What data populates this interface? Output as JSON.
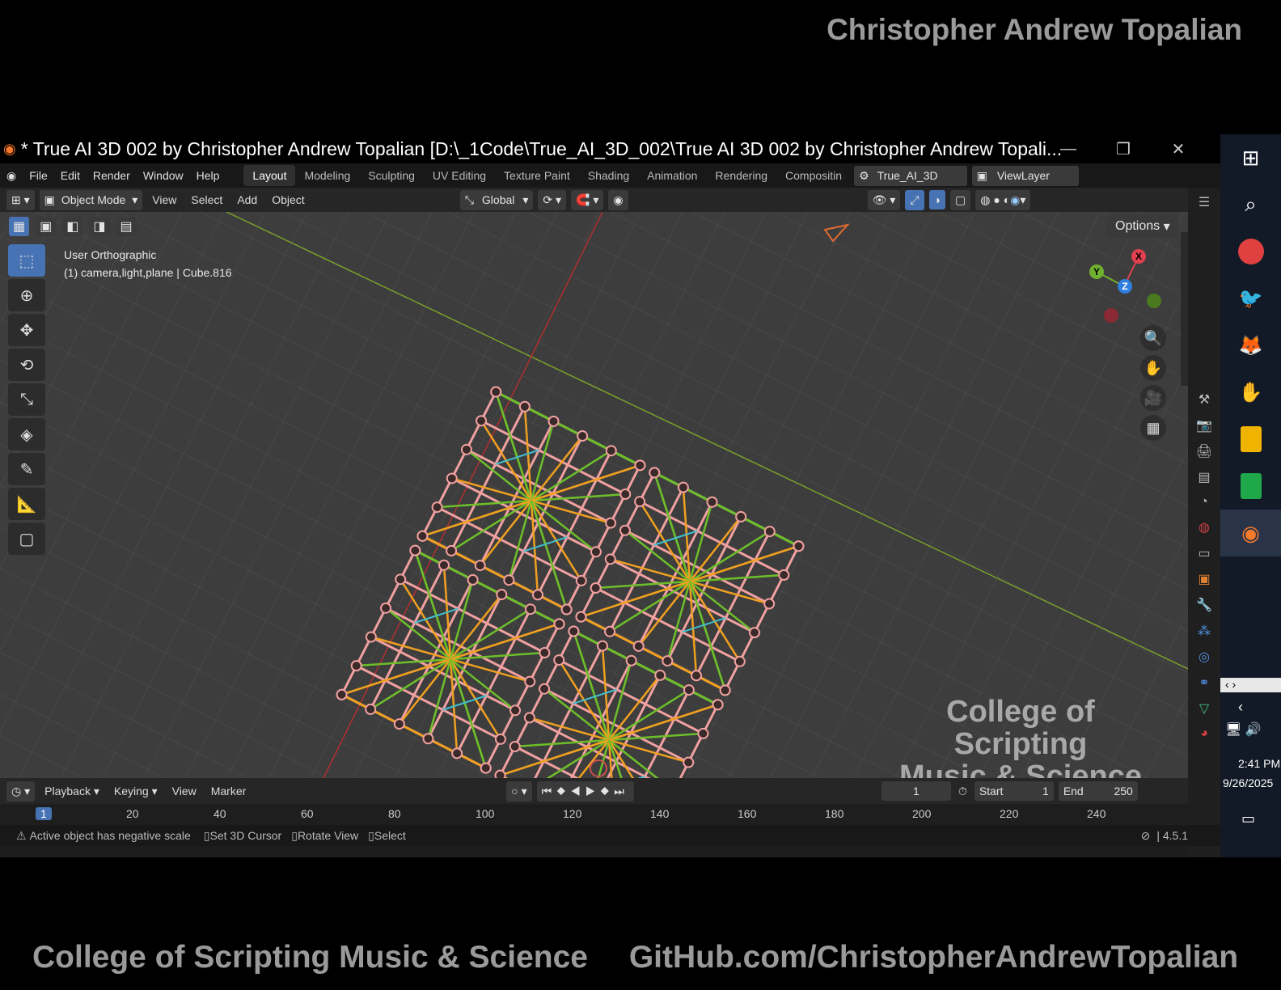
{
  "header_brand": "Christopher Andrew Topalian",
  "footer_brand": [
    "College of Scripting Music & Science",
    "GitHub.com/ChristopherAndrewTopalian"
  ],
  "window": {
    "title": "* True AI 3D 002 by Christopher Andrew Topalian [D:\\_1Code\\True_AI_3D_002\\True AI 3D 002 by Christopher Andrew Topali..."
  },
  "menu": [
    "File",
    "Edit",
    "Render",
    "Window",
    "Help"
  ],
  "workspaces": [
    "Layout",
    "Modeling",
    "Sculpting",
    "UV Editing",
    "Texture Paint",
    "Shading",
    "Animation",
    "Rendering",
    "Compositin"
  ],
  "scene_name": "True_AI_3D",
  "view_layer": "ViewLayer",
  "viewport_header": {
    "mode": "Object Mode",
    "menus": [
      "View",
      "Select",
      "Add",
      "Object"
    ],
    "orientation": "Global",
    "options": "Options"
  },
  "viewport": {
    "view_name": "User Orthographic",
    "collection_info": "(1) camera,light,plane | Cube.816",
    "watermark": [
      "College of Scripting",
      "Music & Science"
    ],
    "gizmo": {
      "x": "X",
      "y": "Y",
      "z": "Z"
    }
  },
  "timeline": {
    "menus": [
      "Playback",
      "Keying",
      "View",
      "Marker"
    ],
    "current_frame": "1",
    "start_label": "Start",
    "start": "1",
    "end_label": "End",
    "end": "250",
    "ruler": [
      "1",
      "20",
      "40",
      "60",
      "80",
      "100",
      "120",
      "140",
      "160",
      "180",
      "200",
      "220",
      "240"
    ]
  },
  "status": {
    "warning": "Active object has negative scale",
    "hints": [
      "Set 3D Cursor",
      "Rotate View",
      "Select"
    ],
    "version": "4.5.1"
  },
  "taskbar": {
    "time": "2:41 PM",
    "date": "9/26/2025"
  },
  "colors": {
    "accent": "#4772b3",
    "mesh_orange": "#f0a020",
    "mesh_green": "#6dbf2a",
    "mesh_pink": "#f0a0a0",
    "mesh_cyan": "#40c0d0"
  }
}
